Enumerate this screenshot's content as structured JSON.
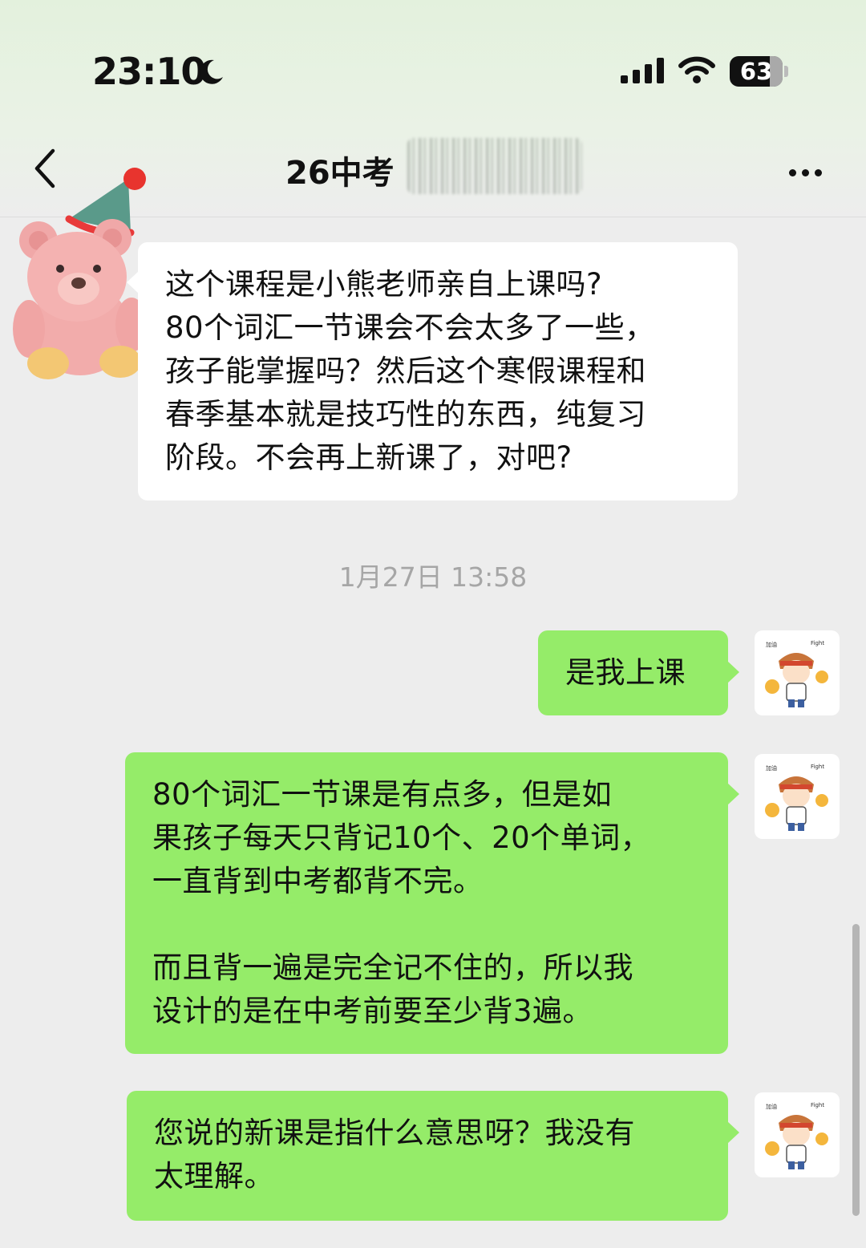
{
  "status_bar": {
    "time": "23:10",
    "battery": "63",
    "icons": [
      "moon-icon",
      "signal-icon",
      "wifi-icon",
      "battery-icon"
    ]
  },
  "header": {
    "title": "26中考",
    "icons": [
      "chevron-left-icon",
      "more-icon"
    ]
  },
  "messages": [
    {
      "side": "left",
      "text": "这个课程是小熊老师亲自上课吗?\n80个词汇一节课会不会太多了一些，\n孩子能掌握吗？然后这个寒假课程和\n春季基本就是技巧性的东西，纯复习\n阶段。不会再上新课了，对吧?"
    },
    {
      "side": "right",
      "text": "是我上课"
    },
    {
      "side": "right",
      "text": "80个词汇一节课是有点多，但是如\n果孩子每天只背记10个、20个单词，\n一直背到中考都背不完。\n\n而且背一遍是完全记不住的，所以我\n设计的是在中考前要至少背3遍。"
    },
    {
      "side": "right",
      "text": "您说的新课是指什么意思呀？我没有\n太理解。"
    }
  ],
  "timestamp": "1月27日 13:58",
  "colors": {
    "chat_background": "#ededed",
    "bubble_incoming": "#ffffff",
    "bubble_outgoing": "#95ec69",
    "timestamp_text": "#a6a6a6"
  }
}
